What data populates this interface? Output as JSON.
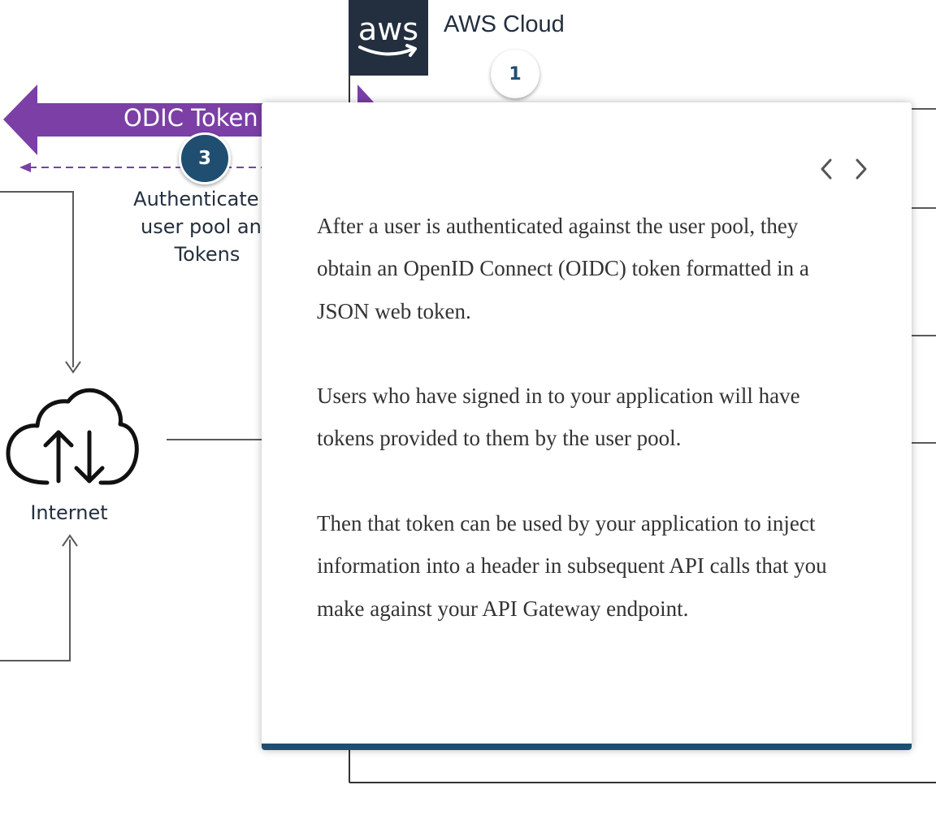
{
  "diagram": {
    "aws_logo_text": "aws",
    "cloud_label": "AWS Cloud",
    "arrow_label": "ODIC Token",
    "auth_label": "Authenticate w\nuser pool and\nTokens",
    "internet_label": "Internet",
    "icon": "cloud-upload-download-icon"
  },
  "steps": {
    "step1": "1",
    "step3": "3"
  },
  "popover": {
    "prev_icon": "chevron-left-icon",
    "next_icon": "chevron-right-icon",
    "paragraphs": [
      "After a user is authenticated against the user pool, they obtain an OpenID Connect (OIDC) token formatted in a JSON web token.",
      "Users who have signed in to your application will have tokens provided to them by the user pool.",
      "Then that token can be used by your application to inject information into a header in subsequent API calls that you make against your API Gateway endpoint."
    ]
  },
  "colors": {
    "accent_navy": "#1f4e70",
    "arrow_purple": "#7b3fa6",
    "aws_dark": "#232f3e",
    "line_gray": "#5a5a5a"
  }
}
